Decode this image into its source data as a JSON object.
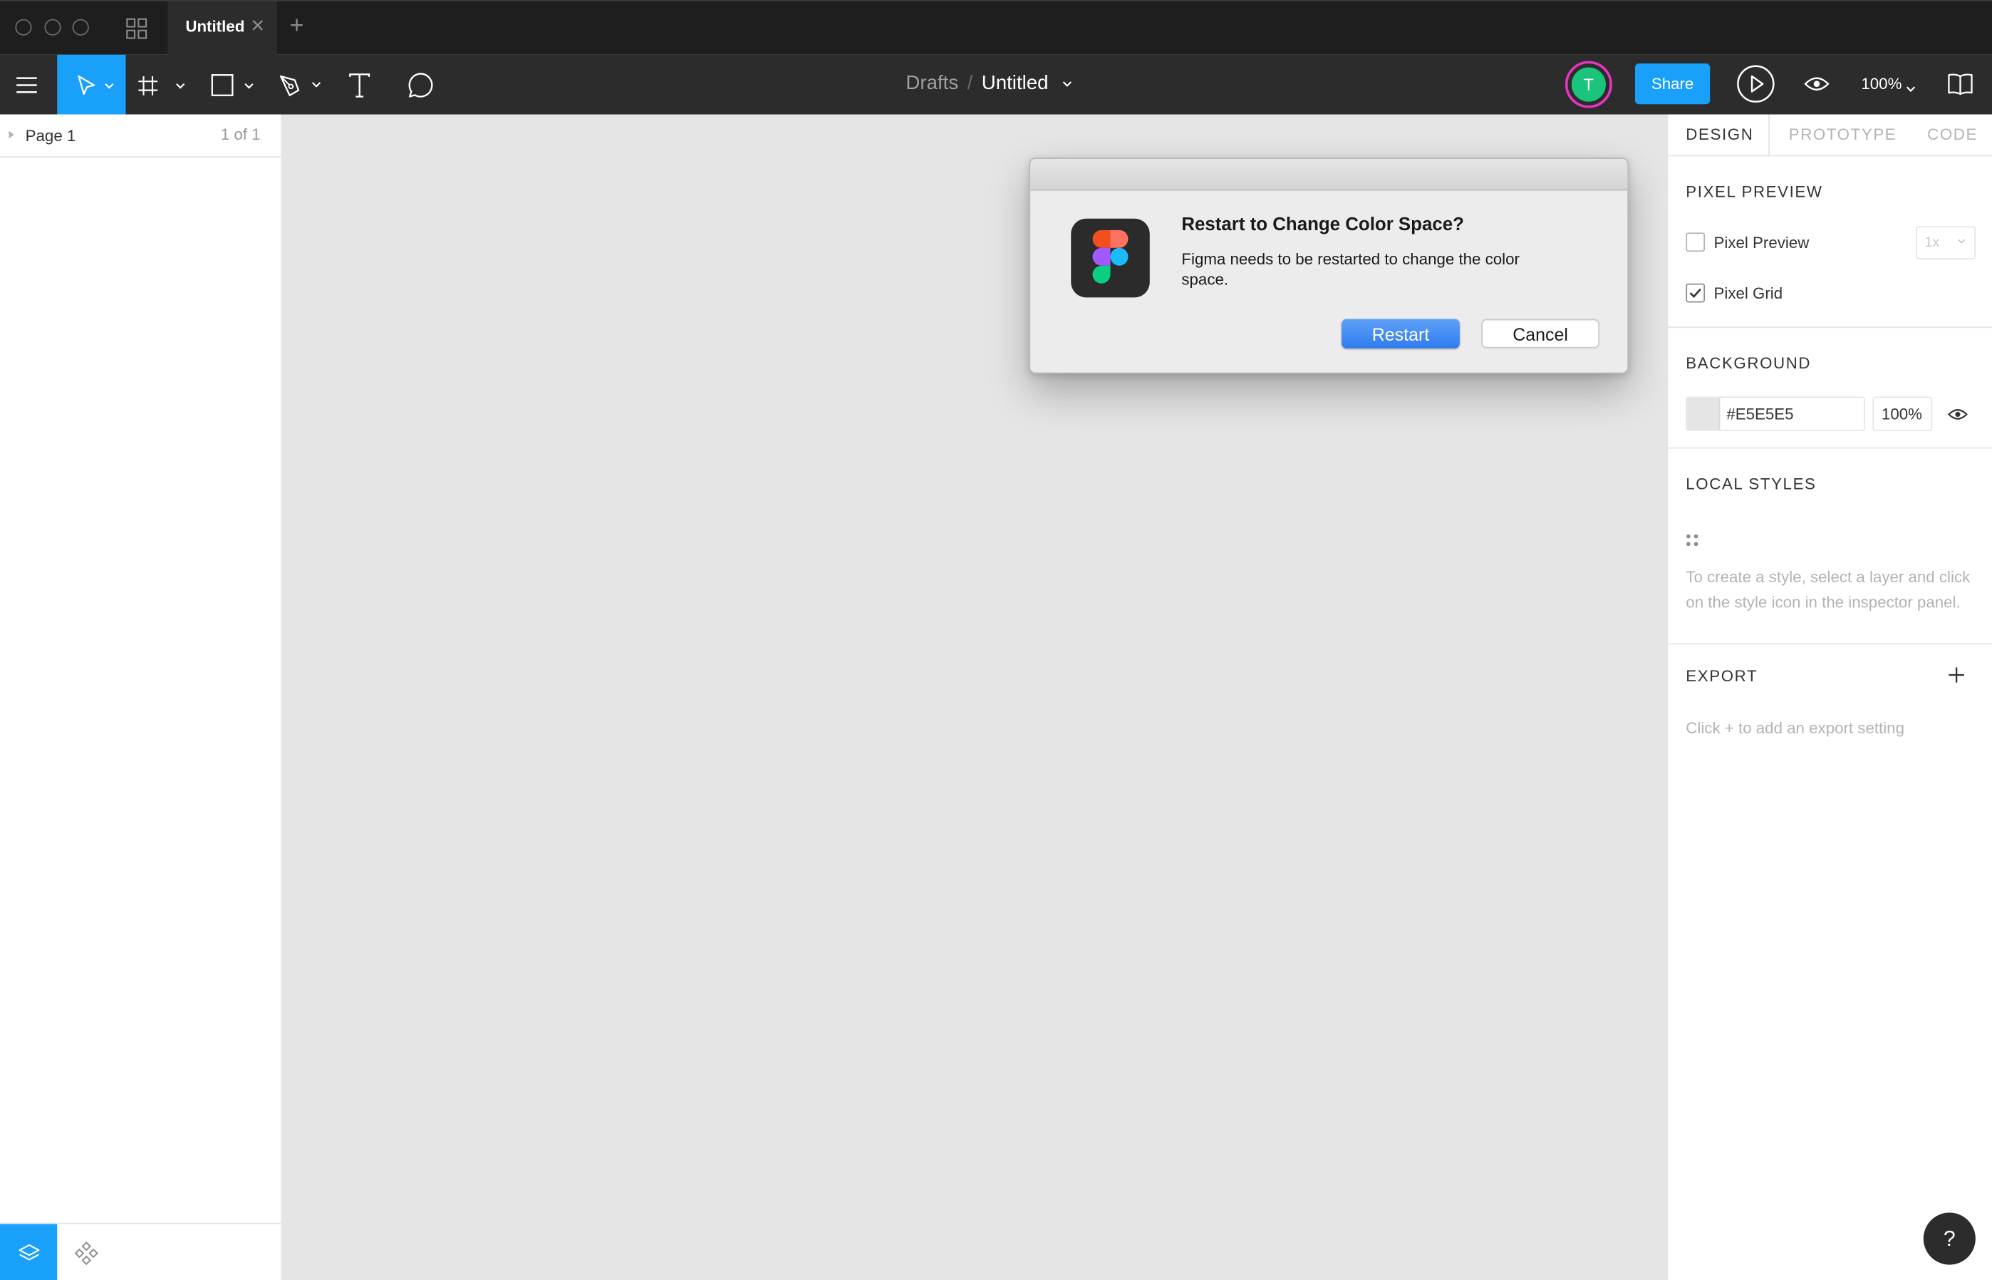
{
  "tabbar": {
    "tab_title": "Untitled",
    "tab_close": "✕",
    "tab_add": "+"
  },
  "toolbar": {
    "breadcrumb_parent": "Drafts",
    "breadcrumb_sep": "/",
    "file_title": "Untitled",
    "avatar_initial": "T",
    "share_label": "Share",
    "zoom_level": "100%"
  },
  "left_panel": {
    "page_name": "Page 1",
    "page_count": "1 of 1"
  },
  "right_panel": {
    "tabs": [
      {
        "label": "DESIGN",
        "active": true
      },
      {
        "label": "PROTOTYPE",
        "active": false
      },
      {
        "label": "CODE",
        "active": false
      }
    ],
    "pixel_preview": {
      "title": "PIXEL PREVIEW",
      "preview_label": "Pixel Preview",
      "preview_checked": false,
      "scale_value": "1x",
      "grid_label": "Pixel Grid",
      "grid_checked": true
    },
    "background": {
      "title": "BACKGROUND",
      "hex": "#E5E5E5",
      "opacity": "100%",
      "color": "#E5E5E5"
    },
    "local_styles": {
      "title": "LOCAL STYLES",
      "hint": "To create a style, select a layer and click on the style icon in the inspector panel."
    },
    "export": {
      "title": "EXPORT",
      "hint": "Click + to add an export setting"
    }
  },
  "help_label": "?",
  "dialog": {
    "title": "Restart to Change Color Space?",
    "message": "Figma needs to be restarted to change the color space.",
    "primary_label": "Restart",
    "secondary_label": "Cancel"
  },
  "icons": {
    "traffic_lights": [
      "window-close-icon",
      "window-minimize-icon",
      "window-zoom-icon"
    ],
    "tools": [
      "move-tool-icon",
      "frame-tool-icon",
      "shape-tool-icon",
      "pen-tool-icon",
      "text-tool-icon",
      "comment-tool-icon"
    ],
    "app_icon": "figma-logo-icon"
  },
  "colors": {
    "accent": "#18A0FB",
    "toolbar_bg": "#2C2C2C",
    "tabbar_bg": "#1E1E1E",
    "canvas_bg": "#E5E5E5",
    "avatar_bg": "#1BC47D",
    "avatar_ring": "#E934C3"
  }
}
